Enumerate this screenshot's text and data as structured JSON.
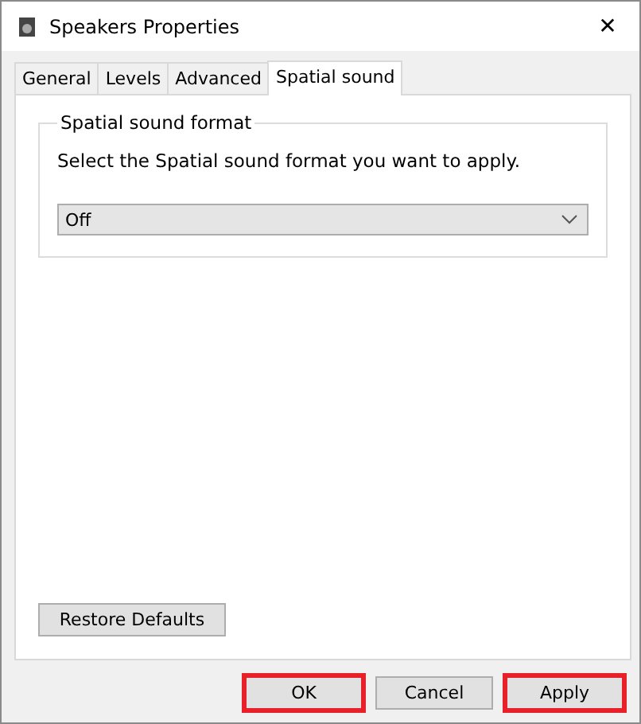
{
  "window": {
    "title": "Speakers Properties",
    "close": "✕"
  },
  "tabs": [
    {
      "label": "General",
      "selected": false
    },
    {
      "label": "Levels",
      "selected": false
    },
    {
      "label": "Advanced",
      "selected": false
    },
    {
      "label": "Spatial sound",
      "selected": true
    }
  ],
  "group": {
    "title": "Spatial sound format",
    "description": "Select the Spatial sound format you want to apply.",
    "dropdown": {
      "value": "Off"
    }
  },
  "restore_button": "Restore Defaults",
  "buttons": [
    {
      "label": "OK",
      "highlighted": true
    },
    {
      "label": "Cancel",
      "highlighted": false
    },
    {
      "label": "Apply",
      "highlighted": true
    }
  ]
}
